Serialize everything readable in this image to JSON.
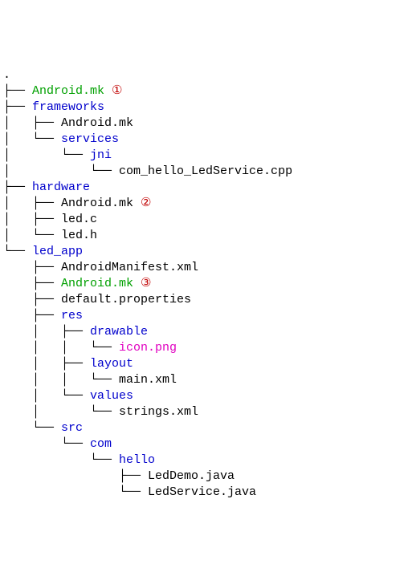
{
  "lines": [
    {
      "branch": "",
      "name": ".",
      "kind": "file"
    },
    {
      "branch": "├── ",
      "name": "Android.mk",
      "kind": "green",
      "annot": "①"
    },
    {
      "branch": "├── ",
      "name": "frameworks",
      "kind": "dir"
    },
    {
      "branch": "│   ├── ",
      "name": "Android.mk",
      "kind": "file"
    },
    {
      "branch": "│   └── ",
      "name": "services",
      "kind": "dir"
    },
    {
      "branch": "│       └── ",
      "name": "jni",
      "kind": "dir"
    },
    {
      "branch": "│           └── ",
      "name": "com_hello_LedService.cpp",
      "kind": "file"
    },
    {
      "branch": "├── ",
      "name": "hardware",
      "kind": "dir"
    },
    {
      "branch": "│   ├── ",
      "name": "Android.mk",
      "kind": "file",
      "annot": "②"
    },
    {
      "branch": "│   ├── ",
      "name": "led.c",
      "kind": "file"
    },
    {
      "branch": "│   └── ",
      "name": "led.h",
      "kind": "file"
    },
    {
      "branch": "└── ",
      "name": "led_app",
      "kind": "dir"
    },
    {
      "branch": "    ├── ",
      "name": "AndroidManifest.xml",
      "kind": "file"
    },
    {
      "branch": "    ├── ",
      "name": "Android.mk",
      "kind": "green",
      "annot": "③"
    },
    {
      "branch": "    ├── ",
      "name": "default.properties",
      "kind": "file"
    },
    {
      "branch": "    ├── ",
      "name": "res",
      "kind": "dir"
    },
    {
      "branch": "    │   ├── ",
      "name": "drawable",
      "kind": "dir"
    },
    {
      "branch": "    │   │   └── ",
      "name": "icon.png",
      "kind": "magenta"
    },
    {
      "branch": "    │   ├── ",
      "name": "layout",
      "kind": "dir"
    },
    {
      "branch": "    │   │   └── ",
      "name": "main.xml",
      "kind": "file"
    },
    {
      "branch": "    │   └── ",
      "name": "values",
      "kind": "dir"
    },
    {
      "branch": "    │       └── ",
      "name": "strings.xml",
      "kind": "file"
    },
    {
      "branch": "    └── ",
      "name": "src",
      "kind": "dir"
    },
    {
      "branch": "        └── ",
      "name": "com",
      "kind": "dir"
    },
    {
      "branch": "            └── ",
      "name": "hello",
      "kind": "dir"
    },
    {
      "branch": "                ├── ",
      "name": "LedDemo.java",
      "kind": "file"
    },
    {
      "branch": "                └── ",
      "name": "LedService.java",
      "kind": "file"
    }
  ]
}
